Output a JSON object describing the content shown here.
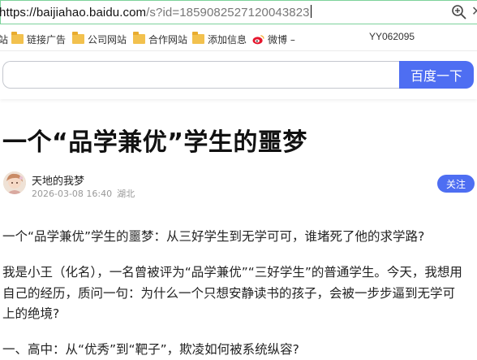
{
  "browser": {
    "url_host": "https://baijiahao.baidu.com",
    "url_rest": "/s?id=1859082527120043823",
    "zoom_icon": "zoom-icon"
  },
  "bookmarks": [
    {
      "label": "站",
      "icon": "folder-icon"
    },
    {
      "label": "链接广告",
      "icon": "folder-icon"
    },
    {
      "label": "公司网站",
      "icon": "folder-icon"
    },
    {
      "label": "合作网站",
      "icon": "folder-icon"
    },
    {
      "label": "添加信息",
      "icon": "folder-icon"
    },
    {
      "label": "微博 –",
      "icon": "weibo-icon"
    }
  ],
  "bookmark_id": "YY062095",
  "search": {
    "button_label": "百度一下",
    "accent_color": "#4e6ef2"
  },
  "article": {
    "title": "一个“品学兼优”学生的噩梦",
    "author": "天地的我梦",
    "date": "2026-03-08 16:40",
    "location": "湖北",
    "follow_label": "关注",
    "paragraphs": [
      "一个“品学兼优”学生的噩梦：从三好学生到无学可可，谁堵死了他的求学路?",
      "我是小王（化名），一名曾被评为“品学兼优”“三好学生”的普通学生。今天，我想用",
      "自己的经历，质问一句：为什么一个只想安静读书的孩子，会被一步步逼到无学可",
      "上的绝境?",
      "一、高中：从“优秀”到“靶子”，欺凌如何被系统纵容?"
    ]
  }
}
